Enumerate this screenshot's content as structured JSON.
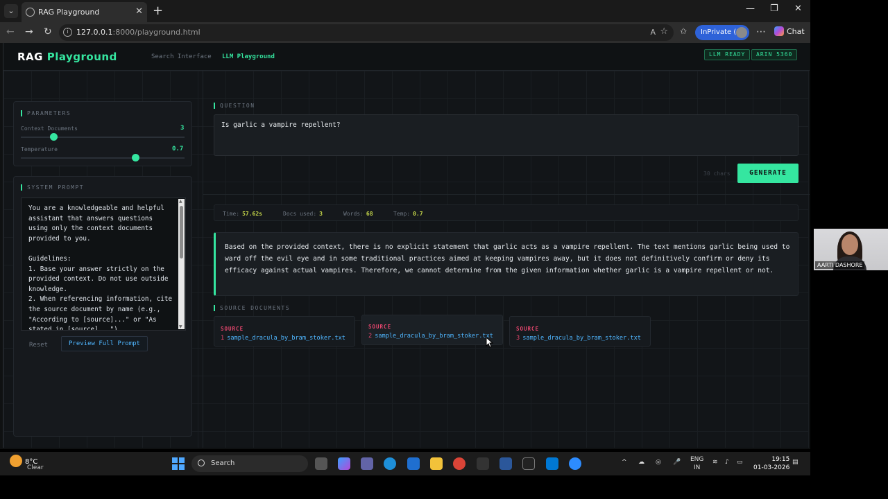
{
  "browser": {
    "tab_title": "RAG Playground",
    "url_host": "127.0.0.1",
    "url_rest": ":8000/playground.html",
    "inprivate": "InPrivate (3)",
    "chat": "Chat"
  },
  "header": {
    "brand_main": "RAG",
    "brand_accent": "Playground",
    "nav": [
      "Search Interface",
      "LLM Playground"
    ],
    "badges": [
      "LLM READY",
      "ARIN 5360"
    ]
  },
  "parameters": {
    "title": "PARAMETERS",
    "context_label": "Context Documents",
    "context_value": "3",
    "context_fraction": 0.2,
    "temp_label": "Temperature",
    "temp_value": "0.7",
    "temp_fraction": 0.7
  },
  "system_prompt": {
    "title": "SYSTEM PROMPT",
    "text": "You are a knowledgeable and helpful assistant that answers questions using only the context documents provided to you.\n\nGuidelines:\n1. Base your answer strictly on the provided context. Do not use outside knowledge.\n2. When referencing information, cite the source document by name (e.g., \"According to [source]...\" or \"As stated in [source]...\")",
    "reset": "Reset",
    "preview": "Preview Full Prompt"
  },
  "question": {
    "title": "QUESTION",
    "value": "Is garlic a vampire repellent?",
    "chars": "30 chars",
    "generate": "GENERATE"
  },
  "stats": [
    {
      "label": "Time:",
      "value": "57.62s"
    },
    {
      "label": "Docs used:",
      "value": "3"
    },
    {
      "label": "Words:",
      "value": "68"
    },
    {
      "label": "Temp:",
      "value": "0.7"
    }
  ],
  "answer": "Based on the provided context, there is no explicit statement that garlic acts as a vampire repellent. The text mentions garlic being used to ward off the evil eye and in some traditional practices aimed at keeping vampires away, but it does not definitively confirm or deny its efficacy against actual vampires. Therefore, we cannot determine from the given information whether garlic is a vampire repellent or not.",
  "sources": {
    "title": "SOURCE DOCUMENTS",
    "label": "SOURCE",
    "items": [
      {
        "num": "1",
        "file": "sample_dracula_by_bram_stoker.txt"
      },
      {
        "num": "2",
        "file": "sample_dracula_by_bram_stoker.txt"
      },
      {
        "num": "3",
        "file": "sample_dracula_by_bram_stoker.txt"
      }
    ]
  },
  "webcam": {
    "name": "AARTI DASHORE"
  },
  "taskbar": {
    "temp": "8°C",
    "condition": "Clear",
    "search": "Search",
    "lang1": "ENG",
    "lang2": "IN",
    "time": "19:15",
    "date": "01-03-2026"
  },
  "colors": {
    "accent": "#35e6a0",
    "link": "#4fb6ff",
    "source": "#e6466e",
    "stat": "#c8d94a"
  }
}
